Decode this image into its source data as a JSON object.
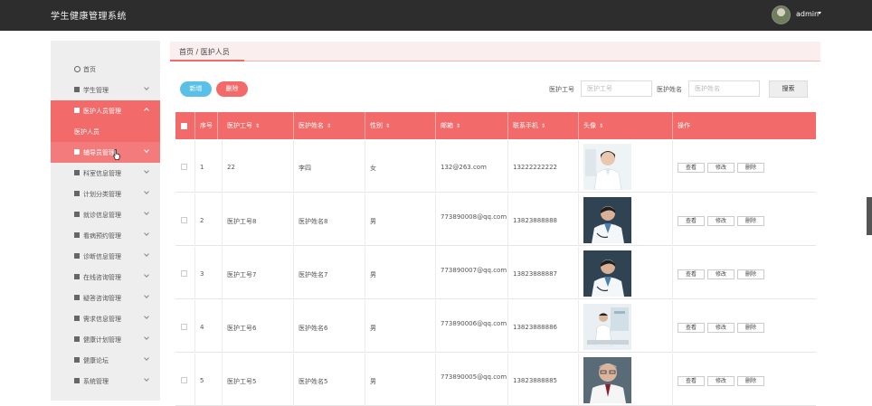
{
  "app": {
    "title": "学生健康管理系统",
    "user": "admin"
  },
  "sidebar": {
    "items": [
      {
        "label": "首页"
      },
      {
        "label": "学生管理"
      },
      {
        "label": "医护人员管理"
      },
      {
        "label": "医护人员"
      },
      {
        "label": "辅导员管理"
      },
      {
        "label": "科室信息管理"
      },
      {
        "label": "计划分类管理"
      },
      {
        "label": "就诊信息管理"
      },
      {
        "label": "看病预约管理"
      },
      {
        "label": "诊断信息管理"
      },
      {
        "label": "在线咨询管理"
      },
      {
        "label": "疑答咨询管理"
      },
      {
        "label": "需求信息管理"
      },
      {
        "label": "健康计划管理"
      },
      {
        "label": "健康论坛"
      },
      {
        "label": "系统管理"
      }
    ]
  },
  "breadcrumb": "首页 / 医护人员",
  "toolbar": {
    "add_label": "新增",
    "delete_label": "删除"
  },
  "search": {
    "id_label": "医护工号",
    "id_placeholder": "医护工号",
    "name_label": "医护姓名",
    "name_placeholder": "医护姓名",
    "button_label": "搜索"
  },
  "table": {
    "headers": [
      "序号",
      "医护工号",
      "医护姓名",
      "性别",
      "邮箱",
      "联系手机",
      "头像",
      "操作"
    ],
    "sort_icon": "⇕",
    "actions": {
      "view": "查看",
      "edit": "修改",
      "delete": "删除"
    },
    "rows": [
      {
        "index": "1",
        "staff_id": "22",
        "name": "李四",
        "gender": "女",
        "email": "132@263.com",
        "phone": "13222222222"
      },
      {
        "index": "2",
        "staff_id": "医护工号8",
        "name": "医护姓名8",
        "gender": "男",
        "email": "773890008@qq.com",
        "phone": "13823888888"
      },
      {
        "index": "3",
        "staff_id": "医护工号7",
        "name": "医护姓名7",
        "gender": "男",
        "email": "773890007@qq.com",
        "phone": "13823888887"
      },
      {
        "index": "4",
        "staff_id": "医护工号6",
        "name": "医护姓名6",
        "gender": "男",
        "email": "773890006@qq.com",
        "phone": "13823888886"
      },
      {
        "index": "5",
        "staff_id": "医护工号5",
        "name": "医护姓名5",
        "gender": "男",
        "email": "773890005@qq.com",
        "phone": "13823888885"
      }
    ]
  },
  "colors": {
    "accent": "#f36a6a",
    "topbar": "#2d2d2d",
    "add_button": "#5bc0e8"
  }
}
